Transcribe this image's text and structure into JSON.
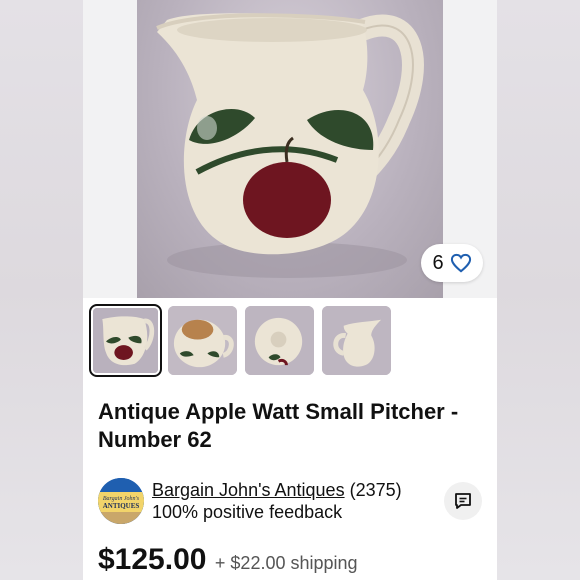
{
  "listing": {
    "title": "Antique Apple Watt Small Pitcher - Number 62",
    "watch_count": "6",
    "price": "$125.00",
    "shipping": "+ $22.00 shipping"
  },
  "seller": {
    "name": "Bargain John's Antiques",
    "feedback_count": "(2375)",
    "feedback_percent": "100% positive feedback",
    "logo_text_line1": "Bargain John's",
    "logo_text_line2": "ANTIQUES"
  },
  "gallery": {
    "thumbnails": [
      {
        "name": "front view",
        "active": true
      },
      {
        "name": "inside view",
        "active": false
      },
      {
        "name": "bottom view",
        "active": false
      },
      {
        "name": "side view",
        "active": false
      }
    ]
  },
  "icons": {
    "watch": "heart-icon",
    "message": "chat-icon"
  },
  "colors": {
    "accent": "#1f5fb0",
    "text": "#111111",
    "muted": "#555555"
  }
}
